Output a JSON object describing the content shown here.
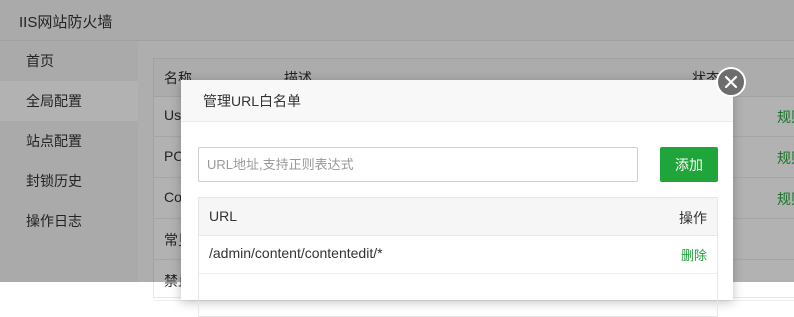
{
  "app": {
    "title": "IIS网站防火墙"
  },
  "sidebar": {
    "items": [
      {
        "label": "首页"
      },
      {
        "label": "全局配置"
      },
      {
        "label": "站点配置"
      },
      {
        "label": "封锁历史"
      },
      {
        "label": "操作日志"
      }
    ]
  },
  "main_table": {
    "headers": {
      "name": "名称",
      "desc": "描述",
      "status": "状态"
    },
    "rows": [
      {
        "name": "Use",
        "action": "规则"
      },
      {
        "name": "PO",
        "action": "规则"
      },
      {
        "name": "Coo",
        "action": "规则"
      },
      {
        "name": "常见"
      },
      {
        "name": "禁止"
      }
    ]
  },
  "modal": {
    "title": "管理URL白名单",
    "input_placeholder": "URL地址,支持正则表达式",
    "add_label": "添加",
    "table": {
      "col_url": "URL",
      "col_action": "操作",
      "rows": [
        {
          "url": "/admin/content/contentedit/*",
          "action": "删除"
        }
      ]
    }
  },
  "colors": {
    "accent": "#20a53a",
    "close_bg": "#6d6d6d"
  }
}
